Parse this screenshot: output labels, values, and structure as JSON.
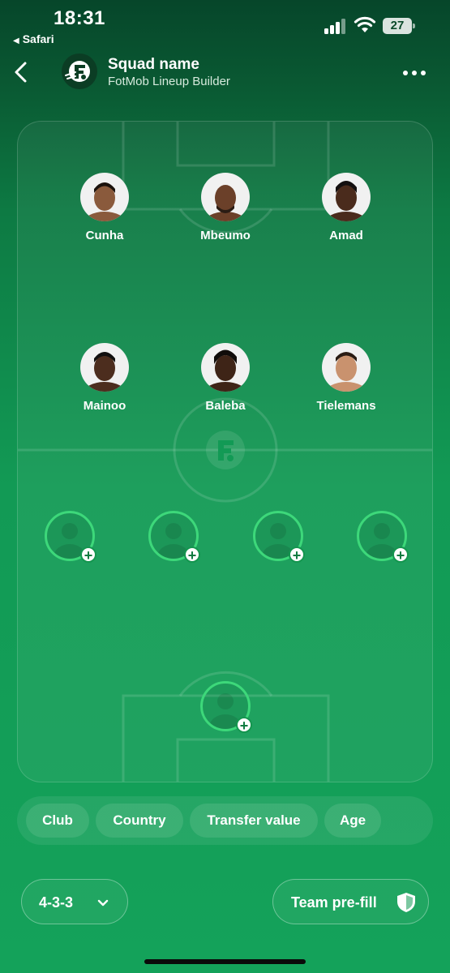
{
  "status_bar": {
    "time": "18:31",
    "back_app": "Safari",
    "battery": "27"
  },
  "header": {
    "title": "Squad name",
    "subtitle": "FotMob Lineup Builder",
    "logo_icon": "fotmob-logo-icon",
    "more_icon": "more-dots-icon"
  },
  "lineup": {
    "forwards": [
      {
        "name": "Cunha",
        "skin": "#8a5a3c",
        "hair": "#1b120d"
      },
      {
        "name": "Mbeumo",
        "skin": "#6b4029",
        "hair": "#2b1c14"
      },
      {
        "name": "Amad",
        "skin": "#4a2b1c",
        "hair": "#141010"
      }
    ],
    "midfielders": [
      {
        "name": "Mainoo",
        "skin": "#4c2d1e",
        "hair": "#121010"
      },
      {
        "name": "Baleba",
        "skin": "#3e2417",
        "hair": "#100c0a"
      },
      {
        "name": "Tielemans",
        "skin": "#c9926e",
        "hair": "#2a1c14"
      }
    ],
    "empty_slot_icon": "add-player-icon",
    "defender_slots": 4,
    "goalkeeper_slots": 1
  },
  "filters": [
    "Club",
    "Country",
    "Transfer value",
    "Age"
  ],
  "bottom": {
    "formation": "4-3-3",
    "prefill_label": "Team pre-fill"
  },
  "colors": {
    "accent_green": "#3dd87a",
    "pitch_green": "#129a55"
  }
}
